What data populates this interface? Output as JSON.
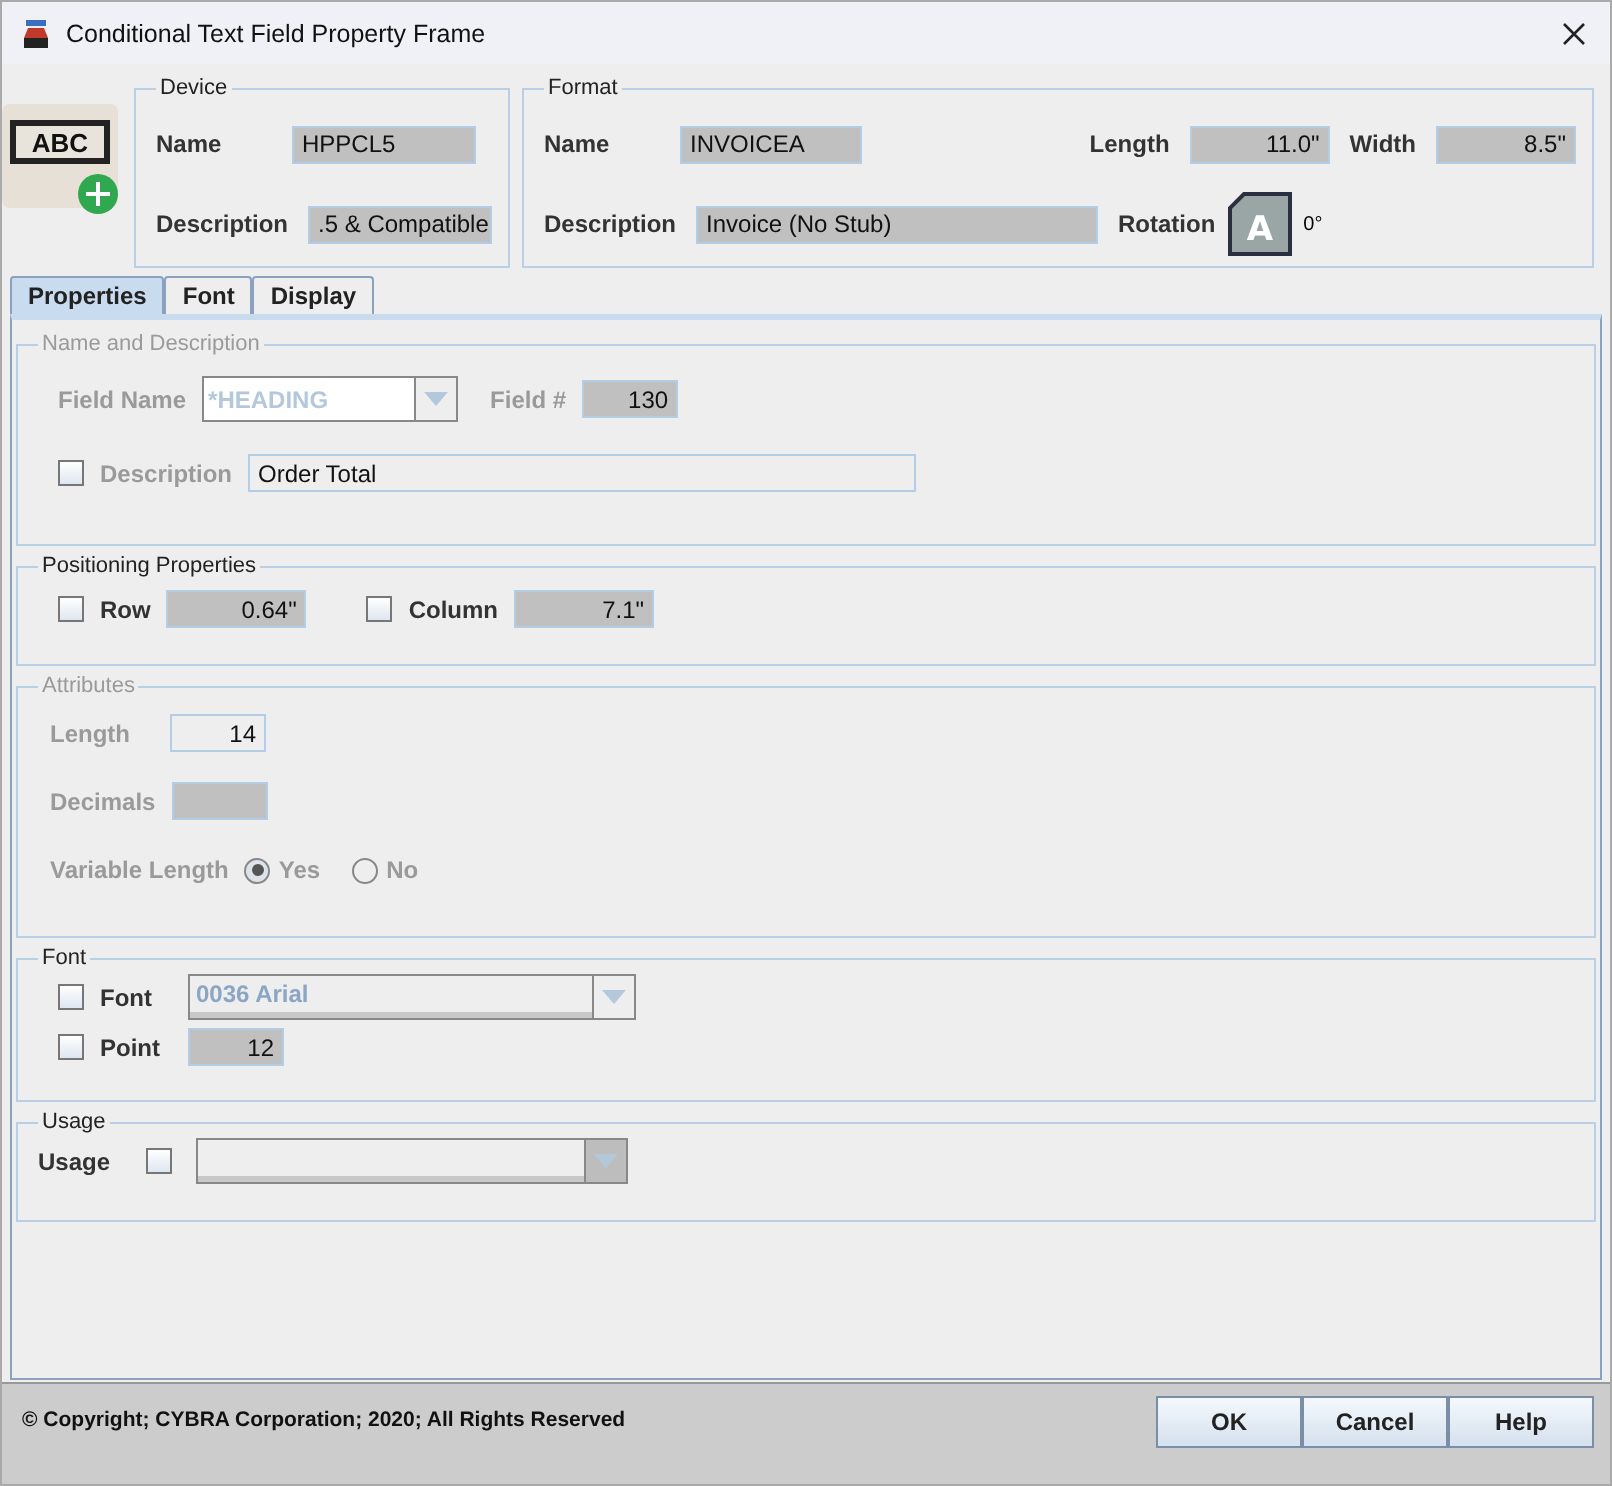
{
  "window": {
    "title": "Conditional Text Field Property Frame"
  },
  "badge": {
    "text": "ABC"
  },
  "device": {
    "legend": "Device",
    "name": {
      "label": "Name",
      "value": "HPPCL5"
    },
    "description": {
      "label": "Description",
      "value": ".5 & Compatible"
    }
  },
  "format": {
    "legend": "Format",
    "name": {
      "label": "Name",
      "value": "INVOICEA"
    },
    "description": {
      "label": "Description",
      "value": "Invoice (No Stub)"
    },
    "length": {
      "label": "Length",
      "value": "11.0\""
    },
    "width": {
      "label": "Width",
      "value": "8.5\""
    },
    "rotation": {
      "label": "Rotation",
      "icon_text": "A",
      "value": "0°"
    }
  },
  "tabs": [
    {
      "label": "Properties",
      "selected": true
    },
    {
      "label": "Font",
      "selected": false
    },
    {
      "label": "Display",
      "selected": false
    }
  ],
  "name_and_description": {
    "legend": "Name and Description",
    "disabled": true,
    "field_name": {
      "label": "Field Name",
      "value": "*HEADING"
    },
    "field_number": {
      "label": "Field #",
      "value": "130"
    },
    "description": {
      "label": "Description",
      "checked": false,
      "value": "Order Total"
    }
  },
  "positioning": {
    "legend": "Positioning Properties",
    "disabled": false,
    "row": {
      "label": "Row",
      "checked": false,
      "value": "0.64\""
    },
    "column": {
      "label": "Column",
      "checked": false,
      "value": "7.1\""
    }
  },
  "attributes": {
    "legend": "Attributes",
    "disabled": true,
    "length": {
      "label": "Length",
      "value": "14"
    },
    "decimals": {
      "label": "Decimals"
    },
    "variable_length": {
      "label": "Variable Length",
      "options": [
        {
          "label": "Yes",
          "selected": true
        },
        {
          "label": "No",
          "selected": false
        }
      ]
    }
  },
  "font": {
    "legend": "Font",
    "disabled": false,
    "font": {
      "label": "Font",
      "checked": false,
      "value": "0036 Arial"
    },
    "point": {
      "label": "Point",
      "checked": false,
      "value": "12"
    }
  },
  "usage": {
    "legend": "Usage",
    "disabled": false,
    "usage": {
      "label": "Usage",
      "checked": false
    }
  },
  "footer": {
    "copyright": "© Copyright; CYBRA Corporation; 2020; All Rights Reserved",
    "buttons": [
      "OK",
      "Cancel",
      "Help"
    ]
  }
}
